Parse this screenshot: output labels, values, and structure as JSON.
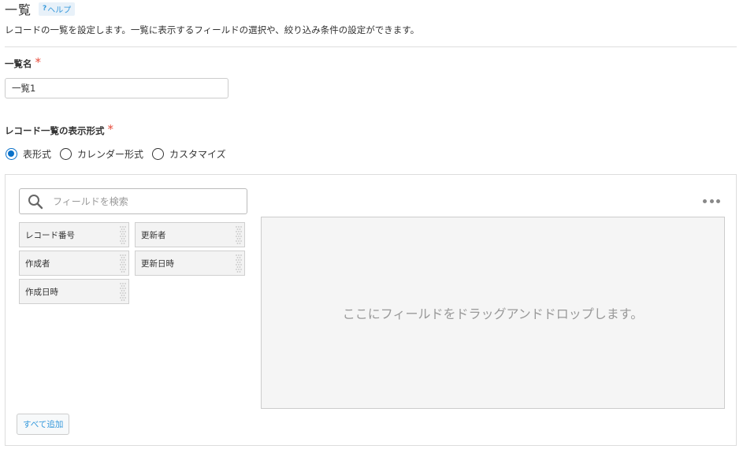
{
  "header": {
    "title": "一覧",
    "help_label": "ヘルプ",
    "help_prefix": "?"
  },
  "description": "レコードの一覧を設定します。一覧に表示するフィールドの選択や、絞り込み条件の設定ができます。",
  "list_name": {
    "label": "一覧名",
    "required_mark": "*",
    "value": "一覧1"
  },
  "display_format": {
    "label": "レコード一覧の表示形式",
    "required_mark": "*",
    "options": [
      {
        "label": "表形式",
        "selected": true
      },
      {
        "label": "カレンダー形式",
        "selected": false
      },
      {
        "label": "カスタマイズ",
        "selected": false
      }
    ]
  },
  "field_panel": {
    "search_placeholder": "フィールドを検索",
    "fields": [
      "レコード番号",
      "更新者",
      "作成者",
      "更新日時",
      "作成日時"
    ],
    "drop_zone_text": "ここにフィールドをドラッグアンドドロップします。",
    "add_all_label": "すべて追加"
  },
  "colors": {
    "accent": "#0a71c9",
    "link": "#3498db",
    "required": "#e74c3c"
  }
}
